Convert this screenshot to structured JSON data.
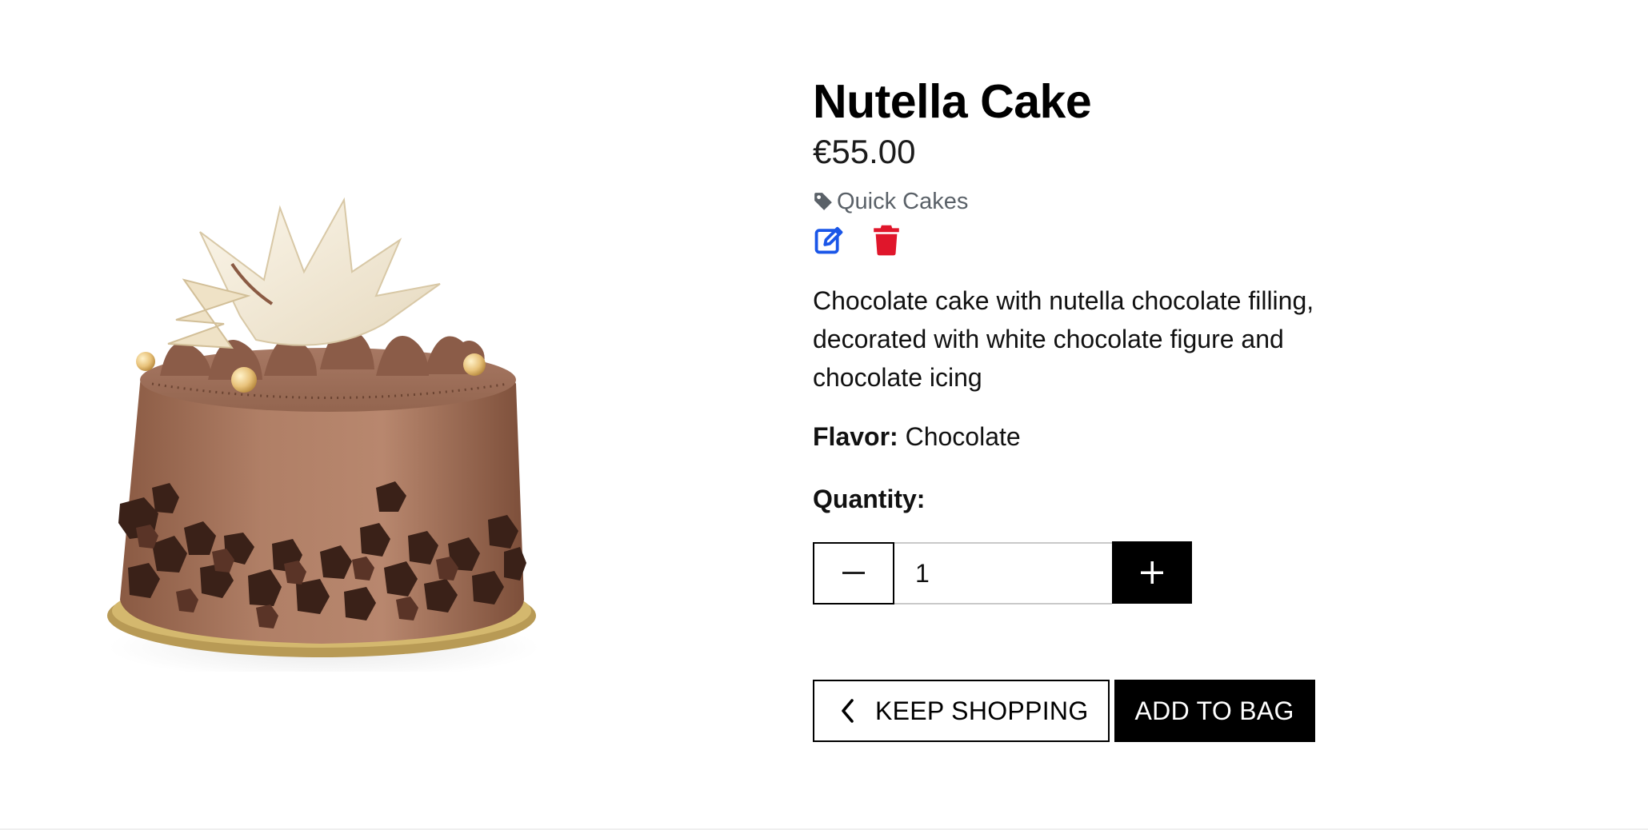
{
  "product": {
    "name": "Nutella Cake",
    "price": "€55.00",
    "category": "Quick Cakes",
    "description": "Chocolate cake with nutella chocolate filling, decorated with white chocolate figure and chocolate icing",
    "flavor_label": "Flavor:",
    "flavor_value": "Chocolate"
  },
  "icons": {
    "category": "tag-icon",
    "edit": "edit-icon",
    "delete": "trash-icon",
    "decrement": "minus-icon",
    "increment": "plus-icon",
    "back": "chevron-left-icon"
  },
  "quantity": {
    "label": "Quantity:",
    "value": "1"
  },
  "actions": {
    "keep_shopping": "KEEP SHOPPING",
    "add_to_bag": "ADD TO BAG"
  },
  "colors": {
    "edit": "#1a56e8",
    "delete": "#e0162b",
    "primary": "#000000",
    "category_text": "#5a6168"
  }
}
